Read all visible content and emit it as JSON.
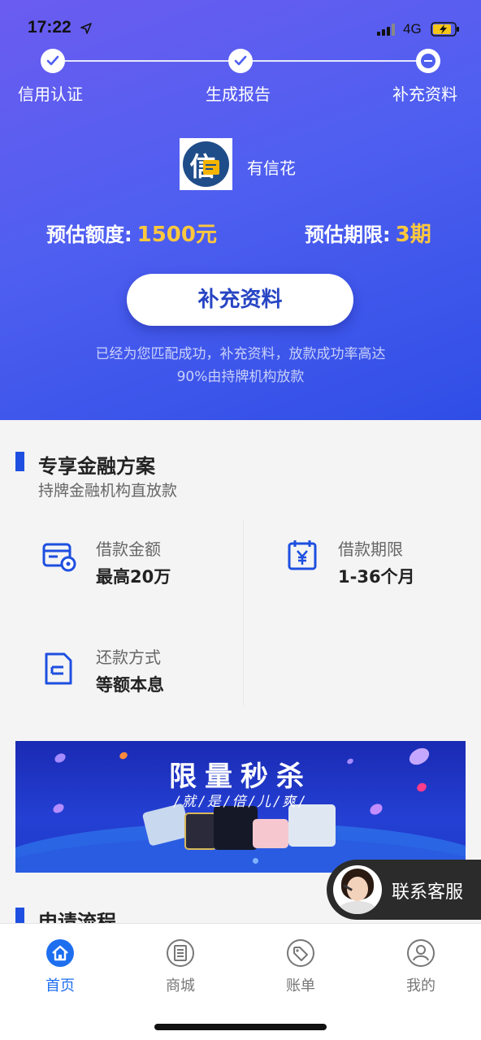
{
  "status_bar": {
    "time": "17:22",
    "network": "4G",
    "icons": [
      "location-arrow-icon",
      "signal-icon",
      "battery-charging-icon"
    ]
  },
  "steps": [
    {
      "label": "信用认证",
      "state": "done"
    },
    {
      "label": "生成报告",
      "state": "done"
    },
    {
      "label": "补充资料",
      "state": "current"
    }
  ],
  "brand": {
    "name": "有信花",
    "logo_glyph": "信",
    "logo_color": "#1f4d8a"
  },
  "estimate": {
    "amount_label": "预估额度:",
    "amount_value": "1500元",
    "term_label": "预估期限:",
    "term_value": "3期"
  },
  "cta": {
    "label": "补充资料"
  },
  "note": {
    "line1": "已经为您匹配成功，补充资料，放款成功率高达",
    "line2": "90%由持牌机构放款"
  },
  "finance_plan": {
    "title": "专享金融方案",
    "subtitle": "持牌金融机构直放款",
    "items": [
      {
        "label": "借款金额",
        "value": "最高20万",
        "icon": "card-icon"
      },
      {
        "label": "借款期限",
        "value": "1-36个月",
        "icon": "calendar-yen-icon"
      },
      {
        "label": "还款方式",
        "value": "等额本息",
        "icon": "document-icon"
      }
    ]
  },
  "banner": {
    "title": "限量秒杀",
    "subtitle": "/就/是/倍/儿/爽/"
  },
  "contact": {
    "label": "联系客服"
  },
  "apply_flow": {
    "title": "申请流程"
  },
  "tabbar": {
    "tabs": [
      {
        "label": "首页",
        "icon": "home-icon",
        "active": true
      },
      {
        "label": "商城",
        "icon": "shop-icon",
        "active": false
      },
      {
        "label": "账单",
        "icon": "bill-tag-icon",
        "active": false
      },
      {
        "label": "我的",
        "icon": "user-icon",
        "active": false
      }
    ]
  },
  "colors": {
    "accent_blue": "#1e4fe0",
    "highlight_yellow": "#ffc83d",
    "tab_active": "#1e6ff0"
  }
}
